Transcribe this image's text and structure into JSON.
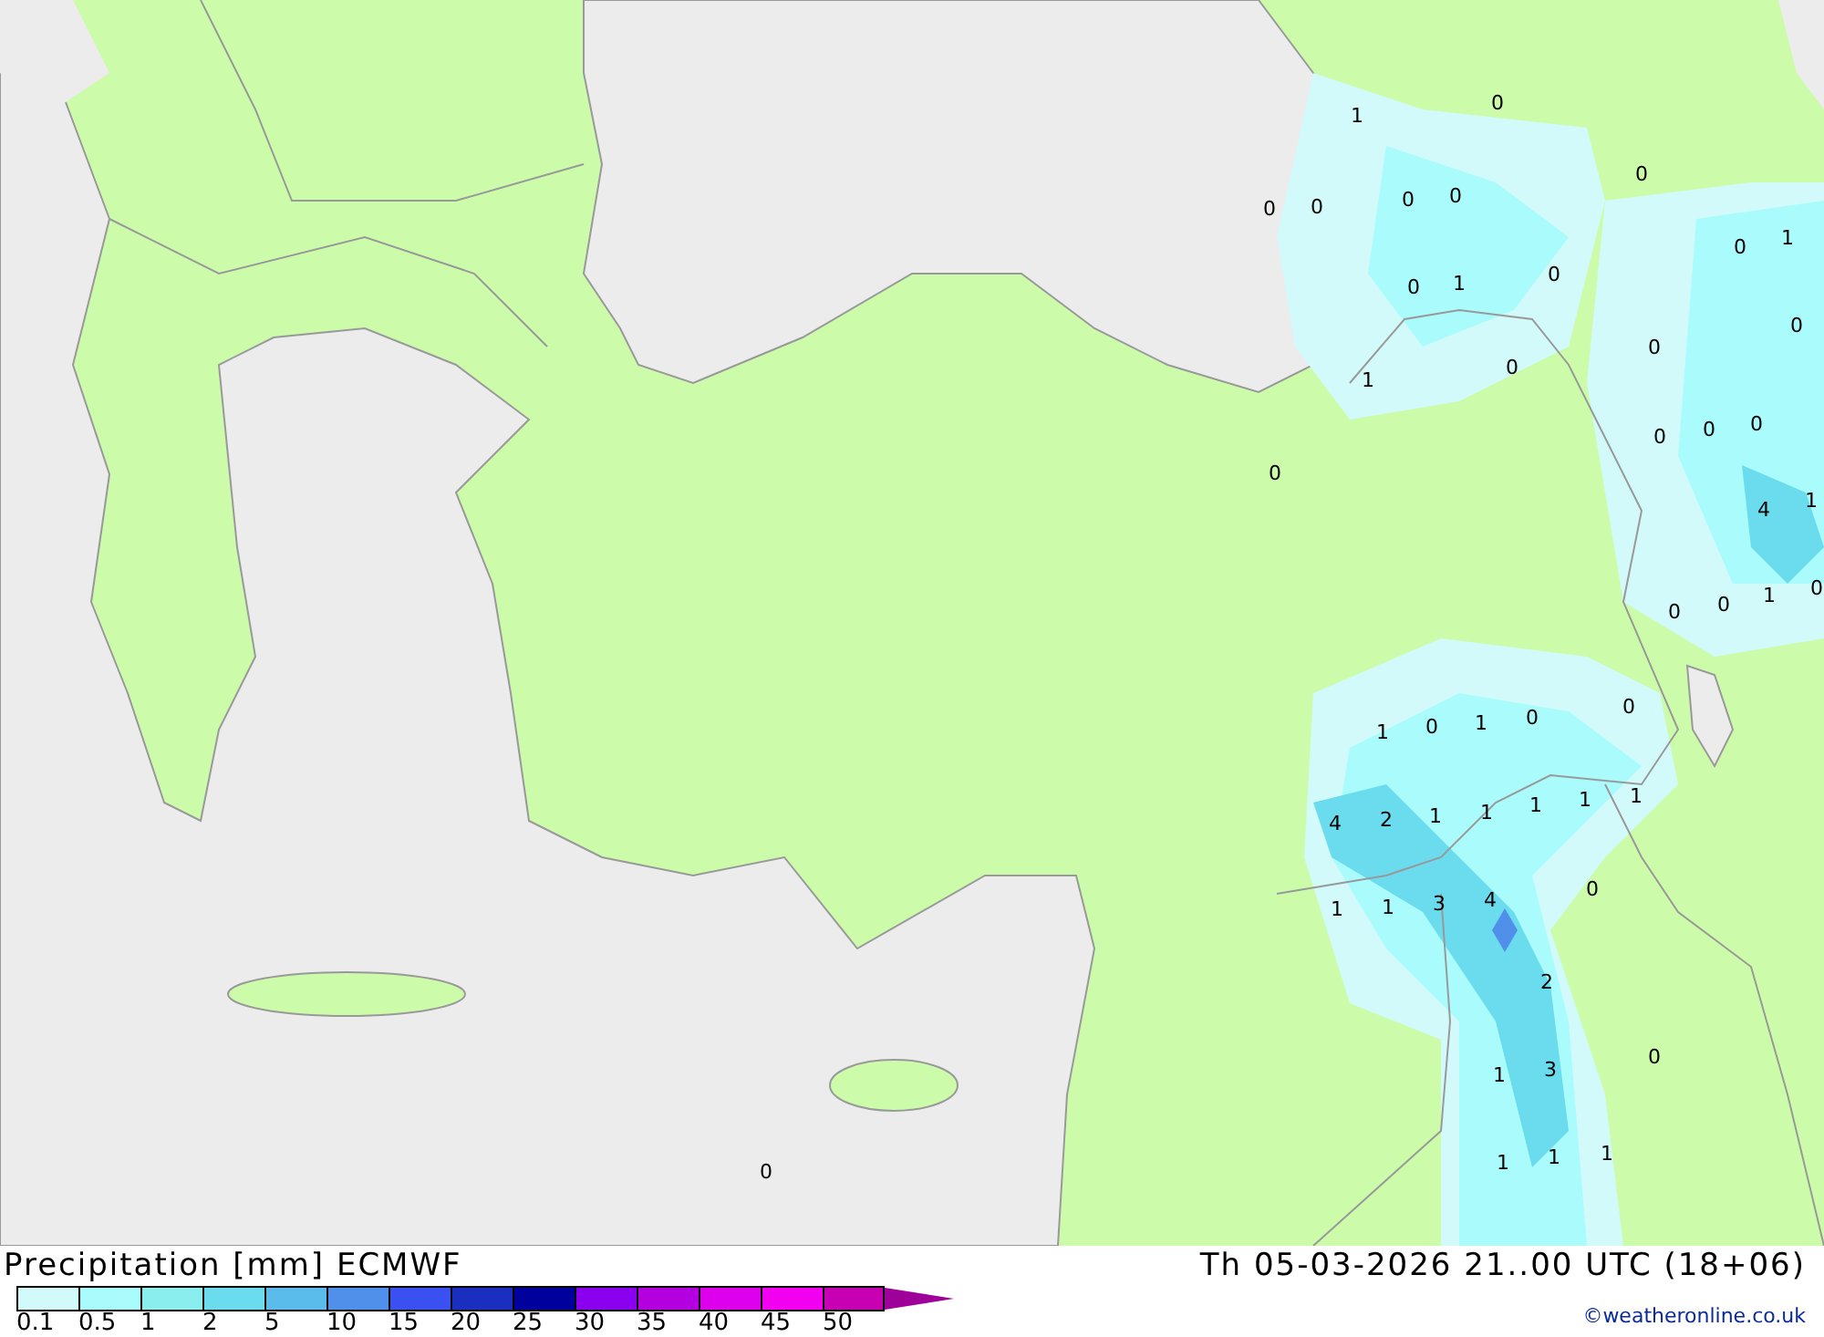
{
  "map": {
    "value_labels": [
      "1",
      "0",
      "0",
      "0",
      "0",
      "0",
      "0",
      "0",
      "1",
      "0",
      "1",
      "0",
      "0",
      "0",
      "1",
      "0",
      "0",
      "0",
      "0",
      "4",
      "1",
      "0",
      "0",
      "0",
      "1",
      "0",
      "0",
      "1",
      "0",
      "1",
      "0",
      "4",
      "2",
      "1",
      "1",
      "1",
      "1",
      "1",
      "0",
      "1",
      "1",
      "3",
      "4",
      "2",
      "1",
      "3",
      "0",
      "1",
      "1",
      "1",
      "0"
    ]
  },
  "legend": {
    "title": "Precipitation [mm] ECMWF",
    "items": [
      {
        "label": "0.1",
        "color": "#d2fafa"
      },
      {
        "label": "0.5",
        "color": "#aafcfc"
      },
      {
        "label": "1",
        "color": "#8aeeee"
      },
      {
        "label": "2",
        "color": "#6adcee"
      },
      {
        "label": "5",
        "color": "#5abcea"
      },
      {
        "label": "10",
        "color": "#5090ea"
      },
      {
        "label": "15",
        "color": "#3a50f0"
      },
      {
        "label": "20",
        "color": "#1a2ec0"
      },
      {
        "label": "25",
        "color": "#00009c"
      },
      {
        "label": "30",
        "color": "#8c00f0"
      },
      {
        "label": "35",
        "color": "#b400e0"
      },
      {
        "label": "40",
        "color": "#dc00ec"
      },
      {
        "label": "45",
        "color": "#f400f0"
      },
      {
        "label": "50",
        "color": "#c800b4"
      }
    ],
    "arrow": {
      "color": "#a0009a"
    }
  },
  "valid_time": "Th 05-03-2026 21..00 UTC (18+06)",
  "credit": "©weatheronline.co.uk"
}
